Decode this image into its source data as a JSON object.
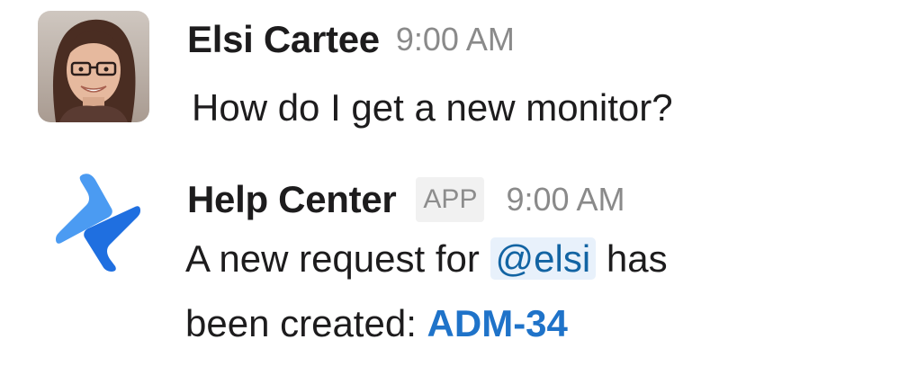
{
  "messages": [
    {
      "sender": "Elsi Cartee",
      "time": "9:00 AM",
      "text": "How do I get a new monitor?"
    },
    {
      "sender": "Help Center",
      "badge": "APP",
      "time": "9:00 AM",
      "text_before": "A new request for",
      "mention": "@elsi",
      "text_after": "has",
      "text_line2": "been created:",
      "link": "ADM-34"
    }
  ],
  "colors": {
    "mention_bg": "#e8f1fb",
    "mention_text": "#1264a3",
    "link": "#1f73c9",
    "logo_light": "#4b9bf2",
    "logo_dark": "#1f6fe0"
  },
  "icons": {
    "avatar": "user-photo-avatar",
    "app_logo": "help-center-logo-icon"
  }
}
